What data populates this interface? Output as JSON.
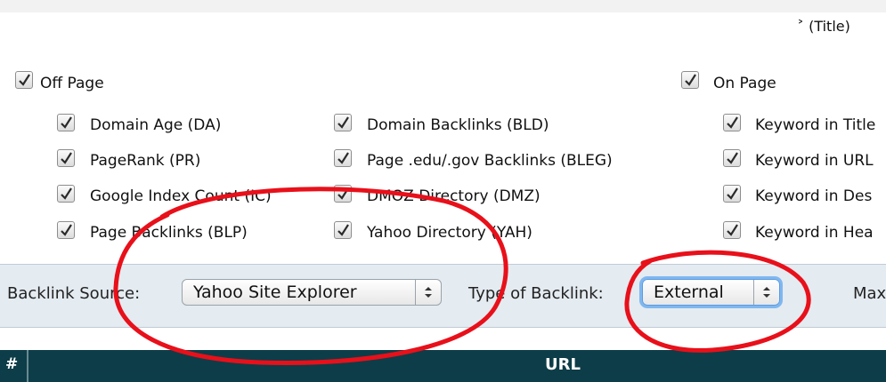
{
  "fragment_title": "˃ (Title)",
  "off_page": {
    "label": "Off Page",
    "checked": true,
    "items": [
      {
        "label": "Domain Age (DA)",
        "checked": true
      },
      {
        "label": "PageRank (PR)",
        "checked": true
      },
      {
        "label": "Google Index Count (IC)",
        "checked": true
      },
      {
        "label": "Page Backlinks (BLP)",
        "checked": true
      },
      {
        "label": "Domain Backlinks (BLD)",
        "checked": true
      },
      {
        "label": "Page .edu/.gov Backlinks (BLEG)",
        "checked": true
      },
      {
        "label": "DMOZ Directory (DMZ)",
        "checked": true
      },
      {
        "label": "Yahoo Directory (YAH)",
        "checked": true
      }
    ]
  },
  "on_page": {
    "label": "On Page",
    "checked": true,
    "items": [
      {
        "label": "Keyword in Title",
        "checked": true
      },
      {
        "label": "Keyword in URL",
        "checked": true
      },
      {
        "label": "Keyword in Des",
        "checked": true
      },
      {
        "label": "Keyword in Hea",
        "checked": true
      }
    ]
  },
  "backlink_source": {
    "label": "Backlink Source:",
    "value": "Yahoo Site Explorer"
  },
  "type_of_backlink": {
    "label": "Type of Backlink:",
    "value": "External"
  },
  "max_label": "Max",
  "table": {
    "num_header": "#",
    "url_header": "URL"
  },
  "colors": {
    "annotation": "#e8101a",
    "table_header_bg": "#0d3d48",
    "panel_bg": "#e4ebf1",
    "focus_ring": "#7fb7f0"
  },
  "icons": [
    "checkmark-icon",
    "stepper-arrows-icon"
  ]
}
